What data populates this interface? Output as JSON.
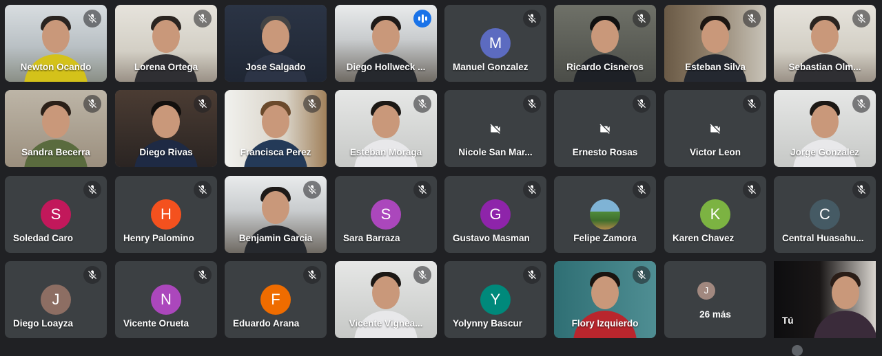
{
  "colors": {
    "background": "#202124",
    "tile": "#3c4043",
    "speaking_border": "#8ab4f8",
    "speaking_badge": "#1a73e8"
  },
  "tiles": [
    {
      "name": "Newton Ocando",
      "kind": "video",
      "muted": true,
      "theme": "office-yellow"
    },
    {
      "name": "Lorena Ortega",
      "kind": "video",
      "muted": true,
      "theme": "home-light"
    },
    {
      "name": "Jose Salgado",
      "kind": "video",
      "muted": false,
      "theme": "dark-blue"
    },
    {
      "name": "Diego Hollweck ...",
      "kind": "video",
      "muted": false,
      "speaking": true,
      "theme": "meeting-room"
    },
    {
      "name": "Manuel Gonzalez",
      "kind": "avatar",
      "muted": true,
      "initial": "M",
      "color": "#5c6bc0"
    },
    {
      "name": "Ricardo Cisneros",
      "kind": "video",
      "muted": true,
      "theme": "office-dark"
    },
    {
      "name": "Esteban Silva",
      "kind": "video",
      "muted": true,
      "theme": "home-shelf"
    },
    {
      "name": "Sebastian Olm...",
      "kind": "video",
      "muted": true,
      "theme": "home-light"
    },
    {
      "name": "Sandra Becerra",
      "kind": "video",
      "muted": true,
      "theme": "home-art"
    },
    {
      "name": "Diego Rivas",
      "kind": "video",
      "muted": true,
      "theme": "home-dark"
    },
    {
      "name": "Francisca Perez",
      "kind": "video",
      "muted": true,
      "theme": "home-window"
    },
    {
      "name": "Esteban Moraga",
      "kind": "video",
      "muted": true,
      "theme": "office-light"
    },
    {
      "name": "Nicole San Mar...",
      "kind": "camoff",
      "muted": true
    },
    {
      "name": "Ernesto Rosas",
      "kind": "camoff",
      "muted": true
    },
    {
      "name": "Victor Leon",
      "kind": "camoff",
      "muted": true
    },
    {
      "name": "Jorge Gonzalez",
      "kind": "video",
      "muted": true,
      "theme": "office-light"
    },
    {
      "name": "Soledad Caro",
      "kind": "avatar",
      "muted": true,
      "initial": "S",
      "color": "#c2185b"
    },
    {
      "name": "Henry Palomino",
      "kind": "avatar",
      "muted": true,
      "initial": "H",
      "color": "#f4511e"
    },
    {
      "name": "Benjamin Garcia",
      "kind": "video",
      "muted": true,
      "theme": "meeting-room"
    },
    {
      "name": "Sara Barraza",
      "kind": "avatar",
      "muted": true,
      "initial": "S",
      "color": "#ab47bc"
    },
    {
      "name": "Gustavo Masman",
      "kind": "avatar",
      "muted": true,
      "initial": "G",
      "color": "#8e24aa"
    },
    {
      "name": "Felipe Zamora",
      "kind": "photo",
      "muted": true
    },
    {
      "name": "Karen Chavez",
      "kind": "avatar",
      "muted": true,
      "initial": "K",
      "color": "#7cb342"
    },
    {
      "name": "Central Huasahu...",
      "kind": "avatar",
      "muted": true,
      "initial": "C",
      "color": "#455a64"
    },
    {
      "name": "Diego Loayza",
      "kind": "avatar",
      "muted": true,
      "initial": "J",
      "color": "#8d6e63"
    },
    {
      "name": "Vicente Orueta",
      "kind": "avatar",
      "muted": true,
      "initial": "N",
      "color": "#ab47bc"
    },
    {
      "name": "Eduardo Arana",
      "kind": "avatar",
      "muted": true,
      "initial": "F",
      "color": "#ef6c00"
    },
    {
      "name": "Vicente Vignea...",
      "kind": "video",
      "muted": true,
      "theme": "office-light"
    },
    {
      "name": "Yolynny Bascur",
      "kind": "avatar",
      "muted": true,
      "initial": "Y",
      "color": "#00897b"
    },
    {
      "name": "Flory Izquierdo",
      "kind": "video",
      "muted": true,
      "theme": "home-teal"
    },
    {
      "name": "26 más",
      "kind": "more",
      "muted": false,
      "initial": "J"
    },
    {
      "name": "Tú",
      "kind": "self",
      "muted": false,
      "theme": "home-dark"
    }
  ]
}
